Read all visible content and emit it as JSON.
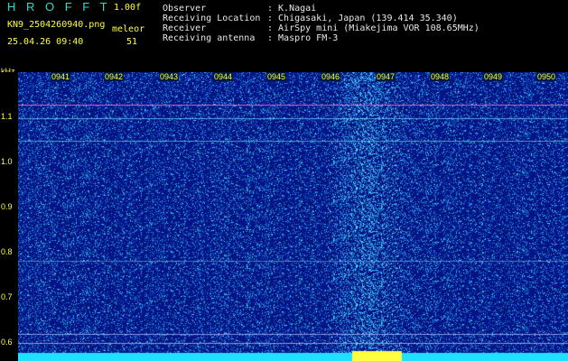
{
  "header": {
    "app_title": "H R O F F T",
    "version": "1.00f",
    "filename": "KN9_2504260940.png",
    "mode": "meleor",
    "datetime": "25.04.26 09:40",
    "count": "51",
    "fields": [
      {
        "label": "Observer",
        "value": ": K.Nagai"
      },
      {
        "label": "Receiving Location",
        "value": ": Chigasaki, Japan (139.414 35.340)"
      },
      {
        "label": "Receiver",
        "value": ": AirSpy mini (Miakejima VOR 108.65MHz)"
      },
      {
        "label": "Receiving antenna",
        "value": ": Maspro FM-3"
      }
    ]
  },
  "axis": {
    "unit": "kHz",
    "y_ticks": [
      "1.1",
      "1.0",
      "0.9",
      "0.8",
      "0.7",
      "0.6"
    ],
    "x_ticks": [
      "0941",
      "0942",
      "0943",
      "0944",
      "0945",
      "0946",
      "0947",
      "0948",
      "0949",
      "0950"
    ]
  },
  "colors": {
    "background": "#000000",
    "waterfall_base": "#0a1a8a",
    "label_yellow": "#ffff40",
    "title_cyan": "#38d8c8"
  }
}
